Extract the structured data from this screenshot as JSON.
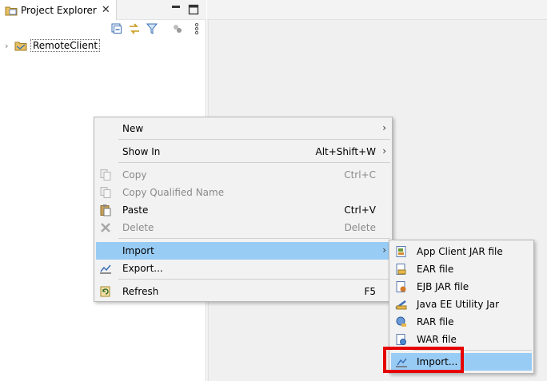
{
  "explorer": {
    "tab_title": "Project Explorer",
    "tab_close": "✕",
    "project": "RemoteClient",
    "twisty": "›"
  },
  "context_menu": {
    "items": [
      {
        "label": "New",
        "accelerator": "",
        "submenu": true,
        "disabled": false
      },
      {
        "label": "Show In",
        "accelerator": "Alt+Shift+W",
        "submenu": true,
        "disabled": false
      },
      {
        "label": "Copy",
        "accelerator": "Ctrl+C",
        "submenu": false,
        "disabled": true
      },
      {
        "label": "Copy Qualified Name",
        "accelerator": "",
        "submenu": false,
        "disabled": true
      },
      {
        "label": "Paste",
        "accelerator": "Ctrl+V",
        "submenu": false,
        "disabled": false
      },
      {
        "label": "Delete",
        "accelerator": "Delete",
        "submenu": false,
        "disabled": true
      },
      {
        "label": "Import",
        "accelerator": "",
        "submenu": true,
        "disabled": false,
        "highlighted": true
      },
      {
        "label": "Export...",
        "accelerator": "",
        "submenu": false,
        "disabled": false
      },
      {
        "label": "Refresh",
        "accelerator": "F5",
        "submenu": false,
        "disabled": false
      }
    ],
    "arrow": "›"
  },
  "import_submenu": {
    "items": [
      {
        "label": "App Client JAR file",
        "icon": "app-client-jar-icon"
      },
      {
        "label": "EAR file",
        "icon": "ear-file-icon"
      },
      {
        "label": "EJB JAR file",
        "icon": "ejb-jar-icon"
      },
      {
        "label": "Java EE Utility Jar",
        "icon": "utility-jar-icon"
      },
      {
        "label": "RAR file",
        "icon": "rar-file-icon"
      },
      {
        "label": "WAR file",
        "icon": "war-file-icon"
      },
      {
        "label": "Import...",
        "icon": "import-wizard-icon",
        "highlighted": true
      }
    ]
  },
  "colors": {
    "menu_highlight": "#99ccf5",
    "annotation_box": "#e60000"
  }
}
